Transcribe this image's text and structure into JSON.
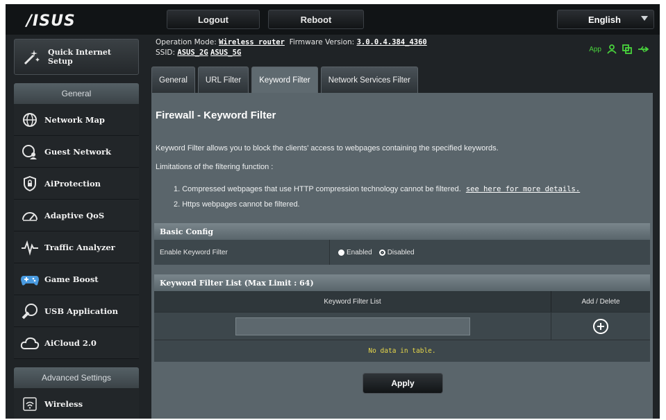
{
  "header": {
    "logo": "/ISUS",
    "logout_label": "Logout",
    "reboot_label": "Reboot",
    "language": "English"
  },
  "info": {
    "op_mode_label": "Operation Mode:",
    "op_mode_value": "Wireless router",
    "fw_label": "Firmware Version:",
    "fw_value": "3.0.0.4.384_4360",
    "ssid_label": "SSID:",
    "ssid_1": "ASUS_2G",
    "ssid_2": "ASUS_5G",
    "app_label": "App"
  },
  "sidebar": {
    "qis_label_1": "Quick Internet",
    "qis_label_2": "Setup",
    "general_label": "General",
    "items": [
      {
        "label": "Network Map"
      },
      {
        "label": "Guest Network"
      },
      {
        "label": "AiProtection"
      },
      {
        "label": "Adaptive QoS"
      },
      {
        "label": "Traffic Analyzer"
      },
      {
        "label": "Game Boost"
      },
      {
        "label": "USB Application"
      },
      {
        "label": "AiCloud 2.0"
      }
    ],
    "advanced_label": "Advanced Settings",
    "adv_items": [
      {
        "label": "Wireless"
      }
    ]
  },
  "tabs": [
    {
      "label": "General"
    },
    {
      "label": "URL Filter"
    },
    {
      "label": "Keyword Filter"
    },
    {
      "label": "Network Services Filter"
    }
  ],
  "panel": {
    "title": "Firewall - Keyword Filter",
    "description": "Keyword Filter allows you to block the clients' access to webpages containing the specified keywords.",
    "limitations_title": "Limitations of the filtering function :",
    "limitation_1": "1. Compressed webpages that use HTTP compression technology cannot be filtered.",
    "limitation_1_link": "see here for more details.",
    "limitation_2": "2. Https webpages cannot be filtered."
  },
  "basic_config": {
    "header": "Basic Config",
    "enable_label": "Enable Keyword Filter",
    "enabled_label": "Enabled",
    "disabled_label": "Disabled",
    "selected": "Enabled"
  },
  "keyword_list": {
    "header": "Keyword Filter List (Max Limit : 64)",
    "col_list": "Keyword Filter List",
    "col_action": "Add / Delete",
    "input_value": "",
    "empty_text": "No data in table."
  },
  "apply_label": "Apply"
}
